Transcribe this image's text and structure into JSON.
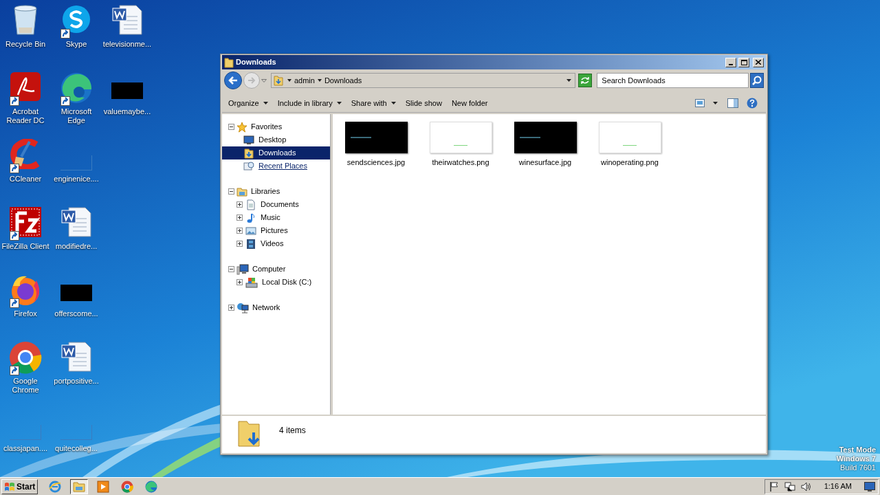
{
  "desktop_columns": [
    [
      {
        "label": "Recycle Bin",
        "kind": "trash",
        "shortcut": false
      },
      {
        "label": "Acrobat Reader DC",
        "kind": "acrobat",
        "shortcut": true
      },
      {
        "label": "CCleaner",
        "kind": "ccleaner",
        "shortcut": true
      },
      {
        "label": "FileZilla Client",
        "kind": "filezilla",
        "shortcut": true
      },
      {
        "label": "Firefox",
        "kind": "firefox",
        "shortcut": true
      },
      {
        "label": "Google Chrome",
        "kind": "chrome",
        "shortcut": true
      },
      {
        "label": "classjapan....",
        "kind": "blank",
        "shortcut": false
      }
    ],
    [
      {
        "label": "Skype",
        "kind": "skype",
        "shortcut": true
      },
      {
        "label": "Microsoft Edge",
        "kind": "edge",
        "shortcut": true
      },
      {
        "label": "enginenice....",
        "kind": "blank",
        "shortcut": false
      },
      {
        "label": "modifiedre...",
        "kind": "word",
        "shortcut": false
      },
      {
        "label": "offerscome...",
        "kind": "dark",
        "shortcut": false
      },
      {
        "label": "portpositive...",
        "kind": "word",
        "shortcut": false
      },
      {
        "label": "quitecolleg...",
        "kind": "blank",
        "shortcut": false
      }
    ],
    [
      {
        "label": "televisionme...",
        "kind": "word",
        "shortcut": false
      },
      {
        "label": "valuemaybe...",
        "kind": "dark",
        "shortcut": false
      }
    ]
  ],
  "window": {
    "title": "Downloads",
    "address": [
      "admin",
      "Downloads"
    ],
    "search": {
      "placeholder": "Search Downloads"
    },
    "toolbar": [
      {
        "label": "Organize",
        "dropdown": true
      },
      {
        "label": "Include in library",
        "dropdown": true
      },
      {
        "label": "Share with",
        "dropdown": true
      },
      {
        "label": "Slide show",
        "dropdown": false
      },
      {
        "label": "New folder",
        "dropdown": false
      }
    ],
    "navigation": [
      {
        "label": "Favorites",
        "kind": "star",
        "expanded": true,
        "children": [
          {
            "label": "Desktop",
            "kind": "desktop",
            "selected": false,
            "hovered": false
          },
          {
            "label": "Downloads",
            "kind": "downloads",
            "selected": true,
            "hovered": false
          },
          {
            "label": "Recent Places",
            "kind": "recent",
            "selected": false,
            "hovered": true
          }
        ]
      },
      {
        "label": "Libraries",
        "kind": "library",
        "expanded": true,
        "children": [
          {
            "label": "Documents",
            "kind": "documents",
            "selected": false,
            "hovered": false,
            "expanded": false
          },
          {
            "label": "Music",
            "kind": "music",
            "selected": false,
            "hovered": false,
            "expanded": false
          },
          {
            "label": "Pictures",
            "kind": "pictures",
            "selected": false,
            "hovered": false,
            "expanded": false
          },
          {
            "label": "Videos",
            "kind": "videos",
            "selected": false,
            "hovered": false,
            "expanded": false
          }
        ]
      },
      {
        "label": "Computer",
        "kind": "computer",
        "expanded": true,
        "children": [
          {
            "label": "Local Disk (C:)",
            "kind": "disk",
            "selected": false,
            "hovered": false,
            "expanded": false
          }
        ]
      },
      {
        "label": "Network",
        "kind": "network",
        "expanded": false
      }
    ],
    "files": [
      {
        "name": "sendsciences.jpg",
        "kind": "dark"
      },
      {
        "name": "theirwatches.png",
        "kind": "light"
      },
      {
        "name": "winesurface.jpg",
        "kind": "dark"
      },
      {
        "name": "winoperating.png",
        "kind": "light"
      }
    ],
    "details": {
      "count": "4 items"
    }
  },
  "test_mode_notice": [
    "Test Mode",
    "Windows 7",
    "Build 7601"
  ],
  "taskbar": {
    "start": "Start",
    "apps": [
      {
        "kind": "ie",
        "selected": false
      },
      {
        "kind": "explorer",
        "selected": true
      },
      {
        "kind": "media",
        "selected": false
      },
      {
        "kind": "chrome",
        "selected": false
      },
      {
        "kind": "edge",
        "selected": false
      }
    ],
    "clock": "1:16 AM"
  }
}
